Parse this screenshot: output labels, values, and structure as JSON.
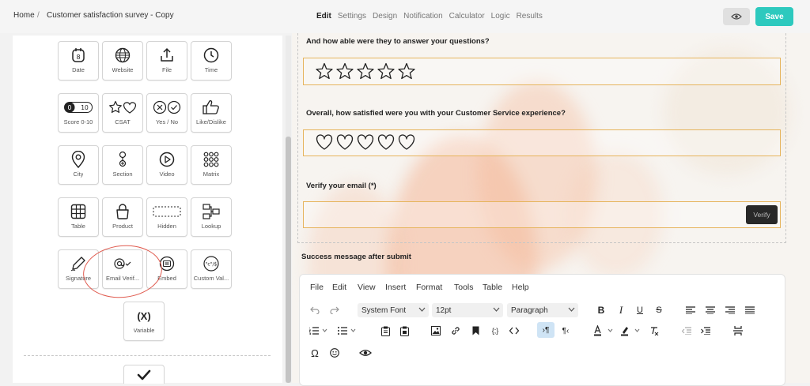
{
  "header": {
    "breadcrumb_home": "Home",
    "breadcrumb_sep": "/",
    "breadcrumb_current": "Customer satisfaction survey - Copy",
    "tabs": [
      "Edit",
      "Settings",
      "Design",
      "Notification",
      "Calculator",
      "Logic",
      "Results"
    ],
    "active_tab": "Edit",
    "save_label": "Save"
  },
  "palette": {
    "tiles": [
      "Date",
      "Website",
      "File",
      "Time",
      "Score 0-10",
      "CSAT",
      "Yes / No",
      "Like/Dislike",
      "City",
      "Section",
      "Video",
      "Matrix",
      "Table",
      "Product",
      "Hidden",
      "Lookup",
      "Signature",
      "Email Verif...",
      "Embed",
      "Custom Val...",
      "Variable"
    ],
    "date_icon_day": "8",
    "score_icon_left": "0",
    "score_icon_right": "10",
    "variable_icon_text": "(X)",
    "custom_icon_text": "\"c\"/$"
  },
  "form": {
    "q1_title": "And how able were they to answer your questions?",
    "q1_rating": {
      "type": "stars",
      "count": 5
    },
    "q2_title": "Overall, how satisfied were you with your Customer Service experience?",
    "q2_rating": {
      "type": "hearts",
      "count": 5
    },
    "q3_title": "Verify your email (*)",
    "verify_label": "Verify",
    "success_label": "Success message after submit"
  },
  "editor": {
    "menu": [
      "File",
      "Edit",
      "View",
      "Insert",
      "Format",
      "Tools",
      "Table",
      "Help"
    ],
    "font_family": "System Font",
    "font_size": "12pt",
    "block_format": "Paragraph"
  },
  "colors": {
    "accent": "#2dc9be",
    "input_border": "#e6b45c",
    "annotation": "#e05b4f",
    "verify_bg": "#282828"
  }
}
